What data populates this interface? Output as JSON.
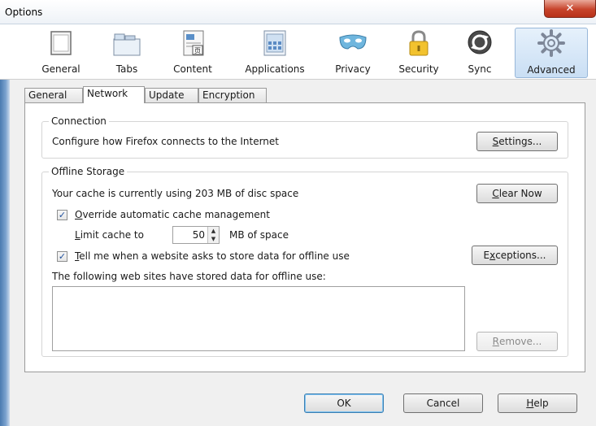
{
  "window": {
    "title": "Options",
    "close_glyph": "✕"
  },
  "panes": [
    {
      "label": "General",
      "icon": "window-icon"
    },
    {
      "label": "Tabs",
      "icon": "tabs-icon"
    },
    {
      "label": "Content",
      "icon": "content-icon"
    },
    {
      "label": "Applications",
      "icon": "applications-icon"
    },
    {
      "label": "Privacy",
      "icon": "mask-icon"
    },
    {
      "label": "Security",
      "icon": "padlock-icon"
    },
    {
      "label": "Sync",
      "icon": "sync-icon"
    },
    {
      "label": "Advanced",
      "icon": "gear-icon"
    }
  ],
  "selected_pane": "Advanced",
  "subtabs": [
    {
      "label": "General"
    },
    {
      "label": "Network"
    },
    {
      "label": "Update"
    },
    {
      "label": "Encryption"
    }
  ],
  "active_subtab": "Network",
  "connection": {
    "title": "Connection",
    "description": "Configure how Firefox connects to the Internet",
    "settings_button": {
      "underline": "S",
      "rest": "ettings..."
    }
  },
  "offline": {
    "title": "Offline Storage",
    "cache_status": "Your cache is currently using 203 MB of disc space",
    "clear_button": {
      "underline": "C",
      "rest": "lear Now"
    },
    "override_checkbox": {
      "underline": "O",
      "rest": "verride automatic cache management",
      "checked": true
    },
    "limit_label": {
      "underline": "L",
      "rest": "imit cache to"
    },
    "limit_value": "50",
    "limit_unit": "MB of space",
    "tell_checkbox": {
      "underline": "T",
      "rest": "ell me when a website asks to store data for offline use",
      "checked": true
    },
    "exceptions_button": {
      "first": "E",
      "underline": "x",
      "rest": "ceptions..."
    },
    "sites_label": "The following web sites have stored data for offline use:",
    "remove_button": {
      "underline": "R",
      "rest": "emove..."
    }
  },
  "footer": {
    "ok": "OK",
    "cancel": "Cancel",
    "help": {
      "underline": "H",
      "rest": "elp"
    }
  },
  "colors": {
    "accent": "#3c7fb1",
    "window_border": "#4a7ab0",
    "close_red": "#c7432b"
  }
}
